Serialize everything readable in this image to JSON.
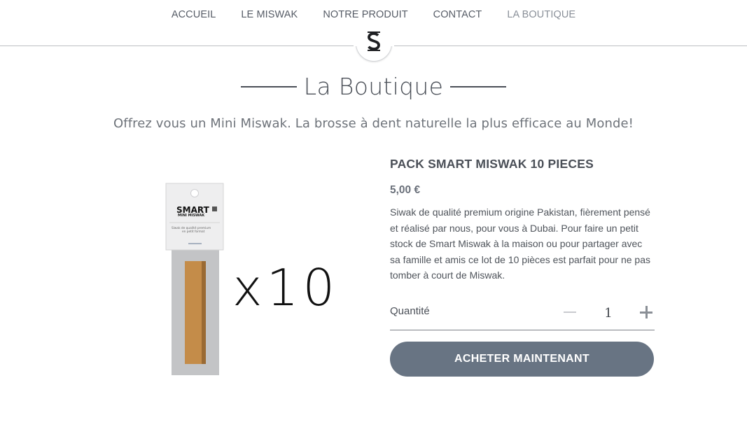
{
  "nav": {
    "items": [
      {
        "label": "ACCUEIL"
      },
      {
        "label": "LE MISWAK"
      },
      {
        "label": "NOTRE PRODUIT"
      },
      {
        "label": "CONTACT"
      },
      {
        "label": "LA BOUTIQUE",
        "active": true
      }
    ],
    "logo_letter": "S"
  },
  "page": {
    "title": "La Boutique",
    "subtitle": "Offrez vous un Mini Miswak. La brosse à dent naturelle la plus efficace au Monde!"
  },
  "product": {
    "image": {
      "package_brand": "SMART",
      "package_line": "MINI MISWAK",
      "package_tagline_1": "Siwak de qualité premium",
      "package_tagline_2": "en petit format",
      "multiplier": "x10"
    },
    "name": "PACK SMART MISWAK 10 PIECES",
    "price": "5,00 €",
    "description": "Siwak de qualité premium origine Pakistan, fièrement pensé et réalisé par nous, pour vous à Dubai. Pour faire un petit stock de Smart Miswak à la maison ou pour partager avec sa famille et amis ce lot de 10 pièces est parfait pour ne pas tomber à court de Miswak.",
    "quantity_label": "Quantité",
    "quantity_value": "1",
    "buy_label": "ACHETER MAINTENANT"
  },
  "colors": {
    "button_bg": "#687483",
    "text": "#4a4f57",
    "nav_active": "#8a9099"
  }
}
